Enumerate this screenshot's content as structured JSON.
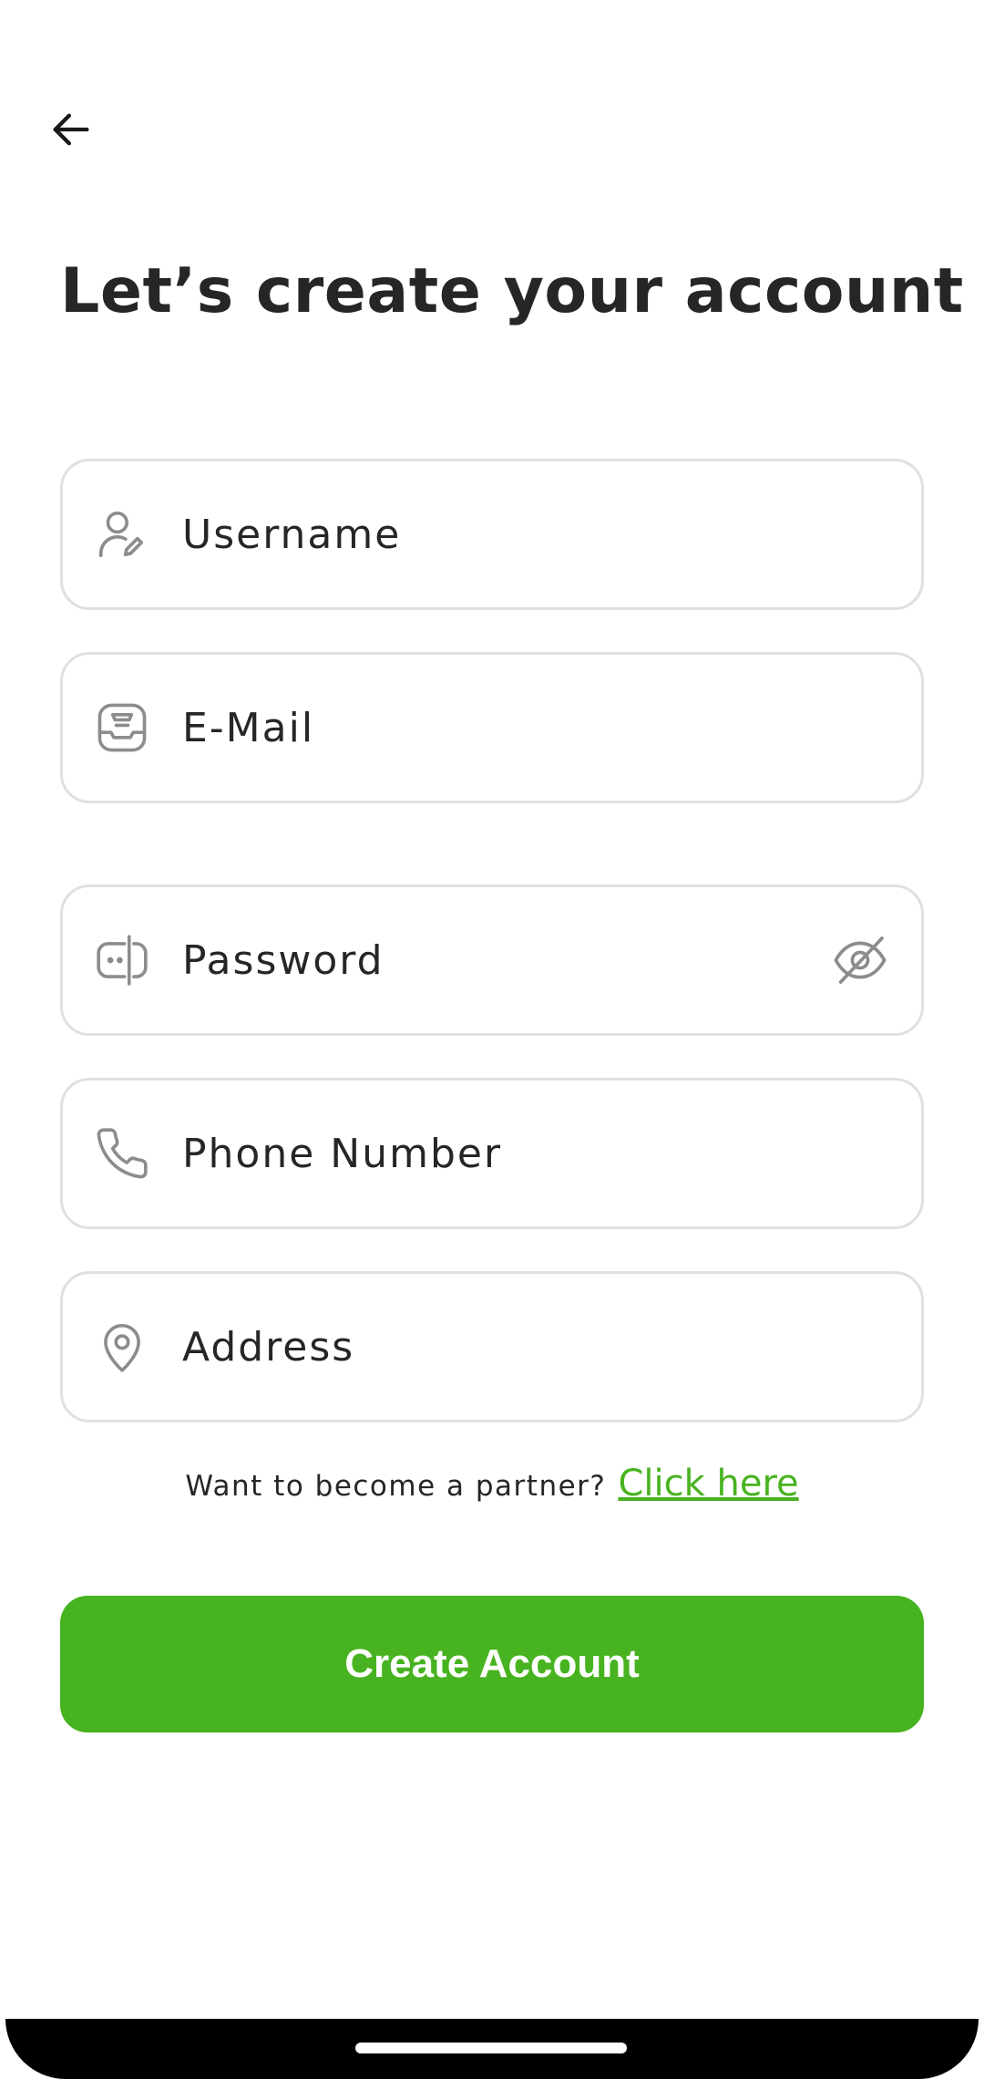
{
  "header": {
    "title": "Let’s create your account"
  },
  "form": {
    "username": {
      "placeholder": "Username",
      "icon": "user-edit-icon"
    },
    "email": {
      "placeholder": "E-Mail",
      "icon": "inbox-icon"
    },
    "password": {
      "placeholder": "Password",
      "icon": "password-icon",
      "toggle_icon": "eye-off-icon"
    },
    "phone": {
      "placeholder": "Phone Number",
      "icon": "phone-icon"
    },
    "address": {
      "placeholder": "Address",
      "icon": "location-pin-icon"
    }
  },
  "partner": {
    "text": "Want to become a partner?",
    "link": "Click here"
  },
  "submit": {
    "label": "Create Account"
  },
  "colors": {
    "accent": "#48B320",
    "text": "#262626",
    "icon": "#8C8C8C",
    "border": "#E0E0E0"
  }
}
